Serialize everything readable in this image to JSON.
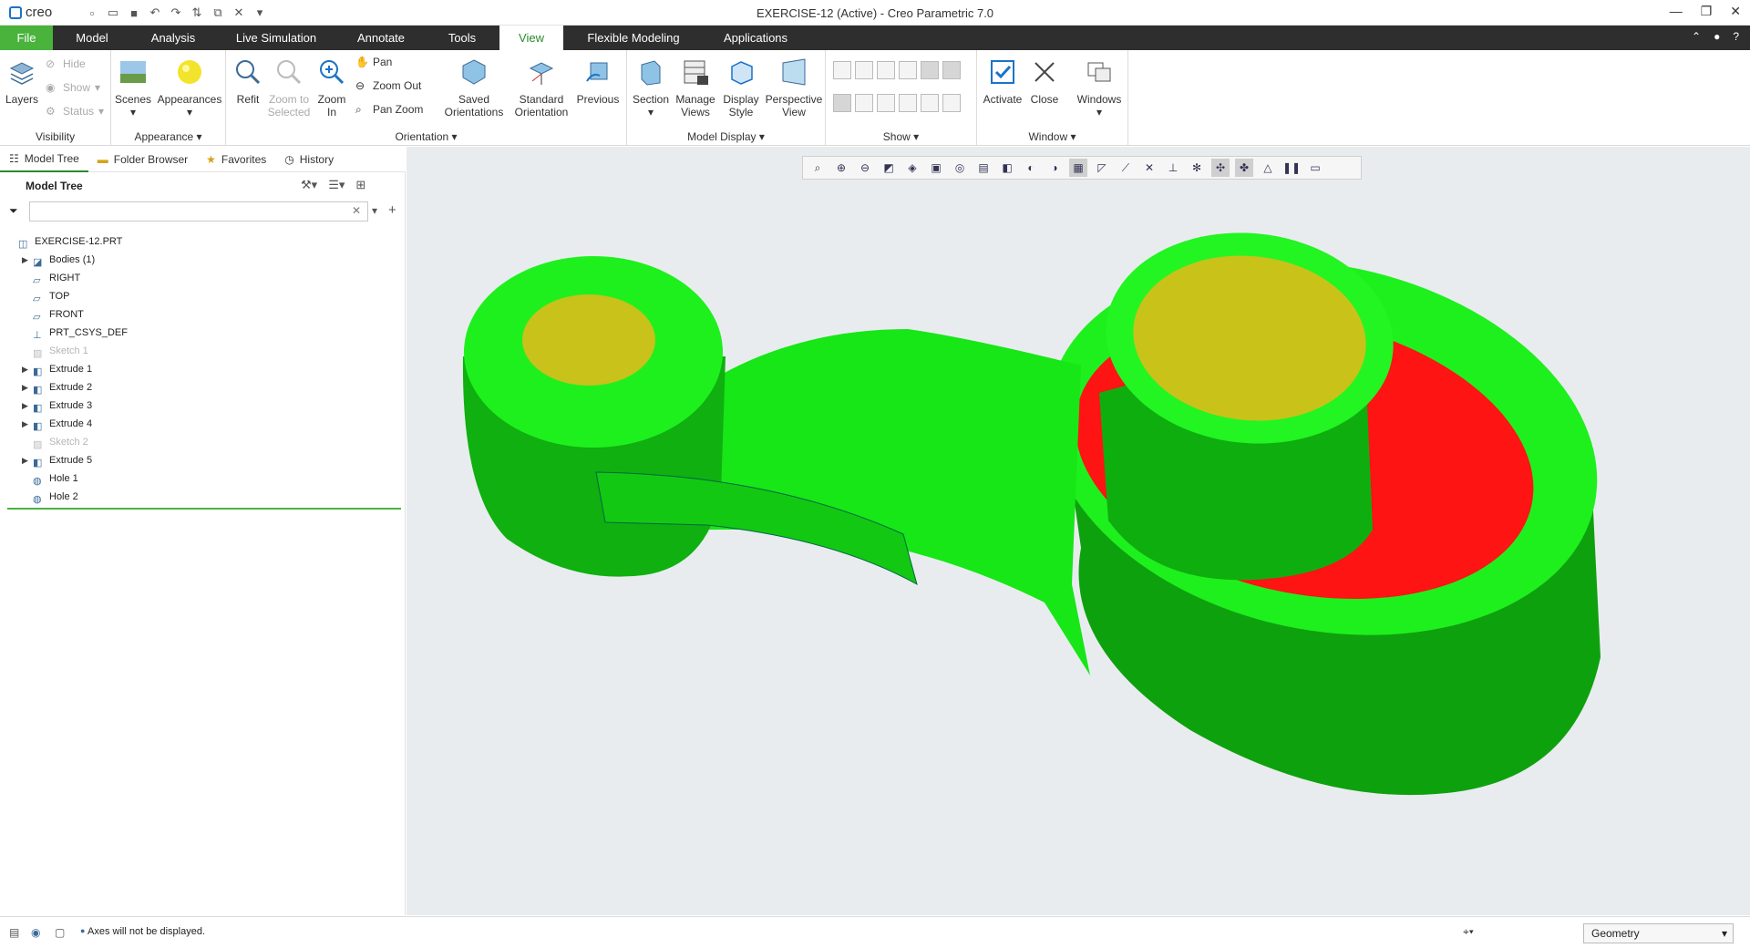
{
  "app": {
    "logo": "creo",
    "title": "EXERCISE-12 (Active) - Creo Parametric 7.0"
  },
  "tabs": [
    "File",
    "Model",
    "Analysis",
    "Live Simulation",
    "Annotate",
    "Tools",
    "View",
    "Flexible Modeling",
    "Applications"
  ],
  "active_tab": "View",
  "ribbon": {
    "visibility": {
      "label": "Visibility",
      "layers": "Layers",
      "hide": "Hide",
      "show": "Show",
      "status": "Status"
    },
    "appearance": {
      "label": "Appearance",
      "scenes": "Scenes",
      "appearances": "Appearances"
    },
    "orientation": {
      "label": "Orientation",
      "refit": "Refit",
      "zoom_to_selected": "Zoom to Selected",
      "zoom_in": "Zoom In",
      "pan": "Pan",
      "zoom_out": "Zoom Out",
      "pan_zoom": "Pan Zoom",
      "saved_orientations": "Saved Orientations",
      "standard_orientation": "Standard Orientation",
      "previous": "Previous"
    },
    "model_display": {
      "label": "Model Display",
      "section": "Section",
      "manage_views": "Manage Views",
      "display_style": "Display Style",
      "perspective_view": "Perspective View"
    },
    "show": {
      "label": "Show"
    },
    "window": {
      "label": "Window",
      "activate": "Activate",
      "close": "Close",
      "windows": "Windows"
    }
  },
  "panel_tabs": [
    "Model Tree",
    "Folder Browser",
    "Favorites",
    "History"
  ],
  "model_tree": {
    "header": "Model Tree",
    "items": [
      {
        "label": "EXERCISE-12.PRT",
        "icon": "part-icon",
        "expand": false,
        "root": true,
        "dim": false
      },
      {
        "label": "Bodies (1)",
        "icon": "bodies-icon",
        "expand": true,
        "dim": false
      },
      {
        "label": "RIGHT",
        "icon": "datum-plane-icon",
        "expand": false,
        "dim": false
      },
      {
        "label": "TOP",
        "icon": "datum-plane-icon",
        "expand": false,
        "dim": false
      },
      {
        "label": "FRONT",
        "icon": "datum-plane-icon",
        "expand": false,
        "dim": false
      },
      {
        "label": "PRT_CSYS_DEF",
        "icon": "csys-icon",
        "expand": false,
        "dim": false
      },
      {
        "label": "Sketch 1",
        "icon": "sketch-icon",
        "expand": false,
        "dim": true
      },
      {
        "label": "Extrude 1",
        "icon": "extrude-icon",
        "expand": true,
        "dim": false
      },
      {
        "label": "Extrude 2",
        "icon": "extrude-icon",
        "expand": true,
        "dim": false
      },
      {
        "label": "Extrude 3",
        "icon": "extrude-icon",
        "expand": true,
        "dim": false
      },
      {
        "label": "Extrude 4",
        "icon": "extrude-icon",
        "expand": true,
        "dim": false
      },
      {
        "label": "Sketch 2",
        "icon": "sketch-icon",
        "expand": false,
        "dim": true
      },
      {
        "label": "Extrude 5",
        "icon": "extrude-icon",
        "expand": true,
        "dim": false
      },
      {
        "label": "Hole 1",
        "icon": "hole-icon",
        "expand": false,
        "dim": false
      },
      {
        "label": "Hole 2",
        "icon": "hole-icon",
        "expand": false,
        "dim": false
      }
    ]
  },
  "status": {
    "message": "Axes will not be displayed.",
    "filter": "Geometry"
  },
  "colors": {
    "accent": "#49b33c",
    "model_green": "#19e619",
    "model_dark_green": "#0b8a0b",
    "hole_yellow": "#c8c21a",
    "cut_red": "#ff1a1a"
  }
}
